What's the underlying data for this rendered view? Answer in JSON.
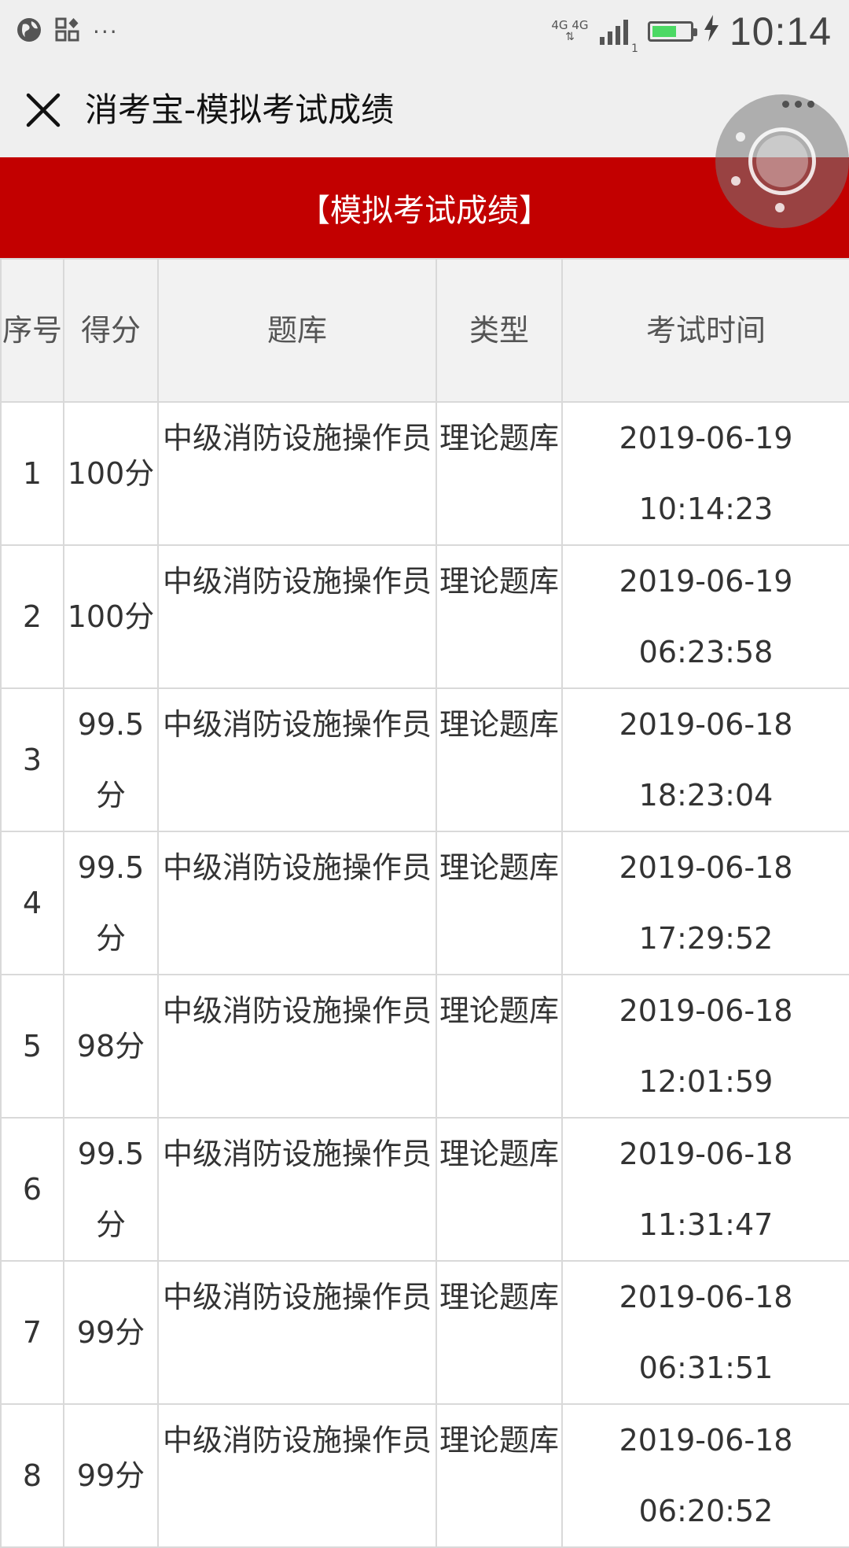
{
  "status_bar": {
    "left_icons": [
      "globe-icon",
      "apps-icon",
      "more-dots-icon"
    ],
    "overflow_text": "···",
    "network_top": "4G 4G",
    "network_bottom": "⇅ ",
    "sim_index": "1",
    "battery_level": 0.65,
    "battery_color": "#4cd964",
    "charging_icon": "bolt-icon",
    "time": "10:14"
  },
  "nav": {
    "title": "消考宝-模拟考试成绩",
    "close_icon": "close-icon",
    "more_icon": "more-horizontal-icon"
  },
  "banner": {
    "text": "【模拟考试成绩】",
    "color": "#c20000"
  },
  "table": {
    "headers": [
      "序号",
      "得分",
      "题库",
      "类型",
      "考试时间"
    ],
    "rows": [
      {
        "index": "1",
        "score": "100分",
        "bank": "中级消防设施操作员",
        "type": "理论题库",
        "date": "2019-06-19",
        "time": "10:14:23"
      },
      {
        "index": "2",
        "score": "100分",
        "bank": "中级消防设施操作员",
        "type": "理论题库",
        "date": "2019-06-19",
        "time": "06:23:58"
      },
      {
        "index": "3",
        "score": "99.5分",
        "bank": "中级消防设施操作员",
        "type": "理论题库",
        "date": "2019-06-18",
        "time": "18:23:04"
      },
      {
        "index": "4",
        "score": "99.5分",
        "bank": "中级消防设施操作员",
        "type": "理论题库",
        "date": "2019-06-18",
        "time": "17:29:52"
      },
      {
        "index": "5",
        "score": "98分",
        "bank": "中级消防设施操作员",
        "type": "理论题库",
        "date": "2019-06-18",
        "time": "12:01:59"
      },
      {
        "index": "6",
        "score": "99.5分",
        "bank": "中级消防设施操作员",
        "type": "理论题库",
        "date": "2019-06-18",
        "time": "11:31:47"
      },
      {
        "index": "7",
        "score": "99分",
        "bank": "中级消防设施操作员",
        "type": "理论题库",
        "date": "2019-06-18",
        "time": "06:31:51"
      },
      {
        "index": "8",
        "score": "99分",
        "bank": "中级消防设施操作员",
        "type": "理论题库",
        "date": "2019-06-18",
        "time": "06:20:52"
      }
    ]
  }
}
